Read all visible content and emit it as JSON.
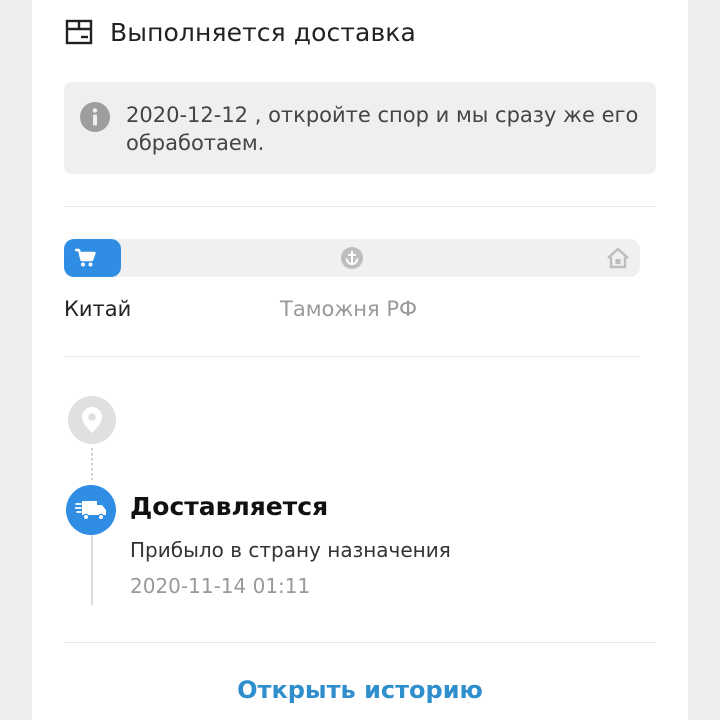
{
  "header": {
    "title": "Выполняется доставка",
    "icon": "package-box-icon"
  },
  "notice": {
    "text": " 2020-12-12 , откройте спор и мы сразу же его обработаем.",
    "icon": "info-icon"
  },
  "progress": {
    "fill_fraction": 0.1,
    "stages": [
      {
        "icon": "shopping-cart-icon",
        "label": "Китай"
      },
      {
        "icon": "anchor-icon",
        "label": "Таможня РФ"
      },
      {
        "icon": "home-icon",
        "label": ""
      }
    ]
  },
  "timeline": {
    "events": [
      {
        "icon": "truck-icon",
        "status": "Доставляется",
        "description": "Прибыло в страну назначения",
        "time": "2020-11-14 01:11"
      }
    ],
    "top_icon": "location-pin-icon"
  },
  "actions": {
    "history_label": "Открыть историю"
  },
  "colors": {
    "accent": "#2f8de4",
    "link": "#2f8fcc",
    "page_bg": "#ededed"
  }
}
